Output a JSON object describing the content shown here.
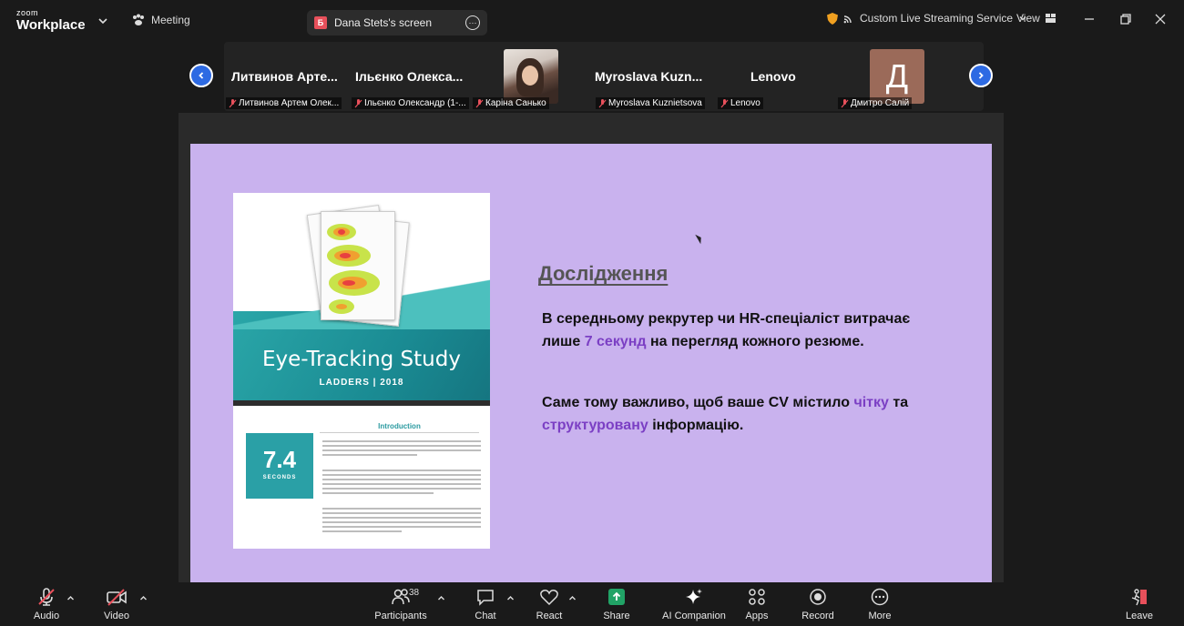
{
  "titlebar": {
    "logo_small": "zoom",
    "logo_big": "Workplace",
    "meeting_label": "Meeting",
    "screen_badge": "Б",
    "screen_label": "Dana Stets's screen",
    "streaming_label": "Custom Live Streaming Service",
    "view_label": "View"
  },
  "participants": {
    "tiles": [
      {
        "name": "Литвинов Арте...",
        "label": "Литвинов Артем Олек..."
      },
      {
        "name": "Ільєнко Олекса...",
        "label": "Ільєнко Олександр (1-..."
      },
      {
        "name": "",
        "label": "Каріна Санько"
      },
      {
        "name": "Myroslava  Kuzn...",
        "label": "Myroslava Kuznietsova"
      },
      {
        "name": "Lenovo",
        "label": "Lenovo"
      },
      {
        "name": "",
        "label": "Дмитро Салій",
        "initial": "Д"
      }
    ]
  },
  "slide": {
    "image_title": "Eye-Tracking Study",
    "image_subtitle": "LADDERS | 2018",
    "intro_heading": "Introduction",
    "stat_value": "7.4",
    "stat_unit": "SECONDS",
    "heading": "Дослідження",
    "para1_a": "В середньому рекрутер чи HR-спеціаліст витрачає лише ",
    "para1_accent": "7 секунд",
    "para1_b": " на перегляд кожного резюме.",
    "para2_a": "Саме тому важливо, щоб ваше CV містило ",
    "para2_accent1": "чітку",
    "para2_b": " та ",
    "para2_accent2": "структуровану",
    "para2_c": " інформацію."
  },
  "toolbar": {
    "audio": "Audio",
    "video": "Video",
    "participants": "Participants",
    "participants_count": "38",
    "chat": "Chat",
    "react": "React",
    "share": "Share",
    "ai_companion": "AI Companion",
    "apps": "Apps",
    "record": "Record",
    "more": "More",
    "leave": "Leave"
  },
  "colors": {
    "slide_bg": "#c9b2ee",
    "accent": "#7b3fc4",
    "nav_arrow": "#2d6ae3",
    "share_green": "#21a366",
    "mic_off_red": "#e8505b"
  }
}
